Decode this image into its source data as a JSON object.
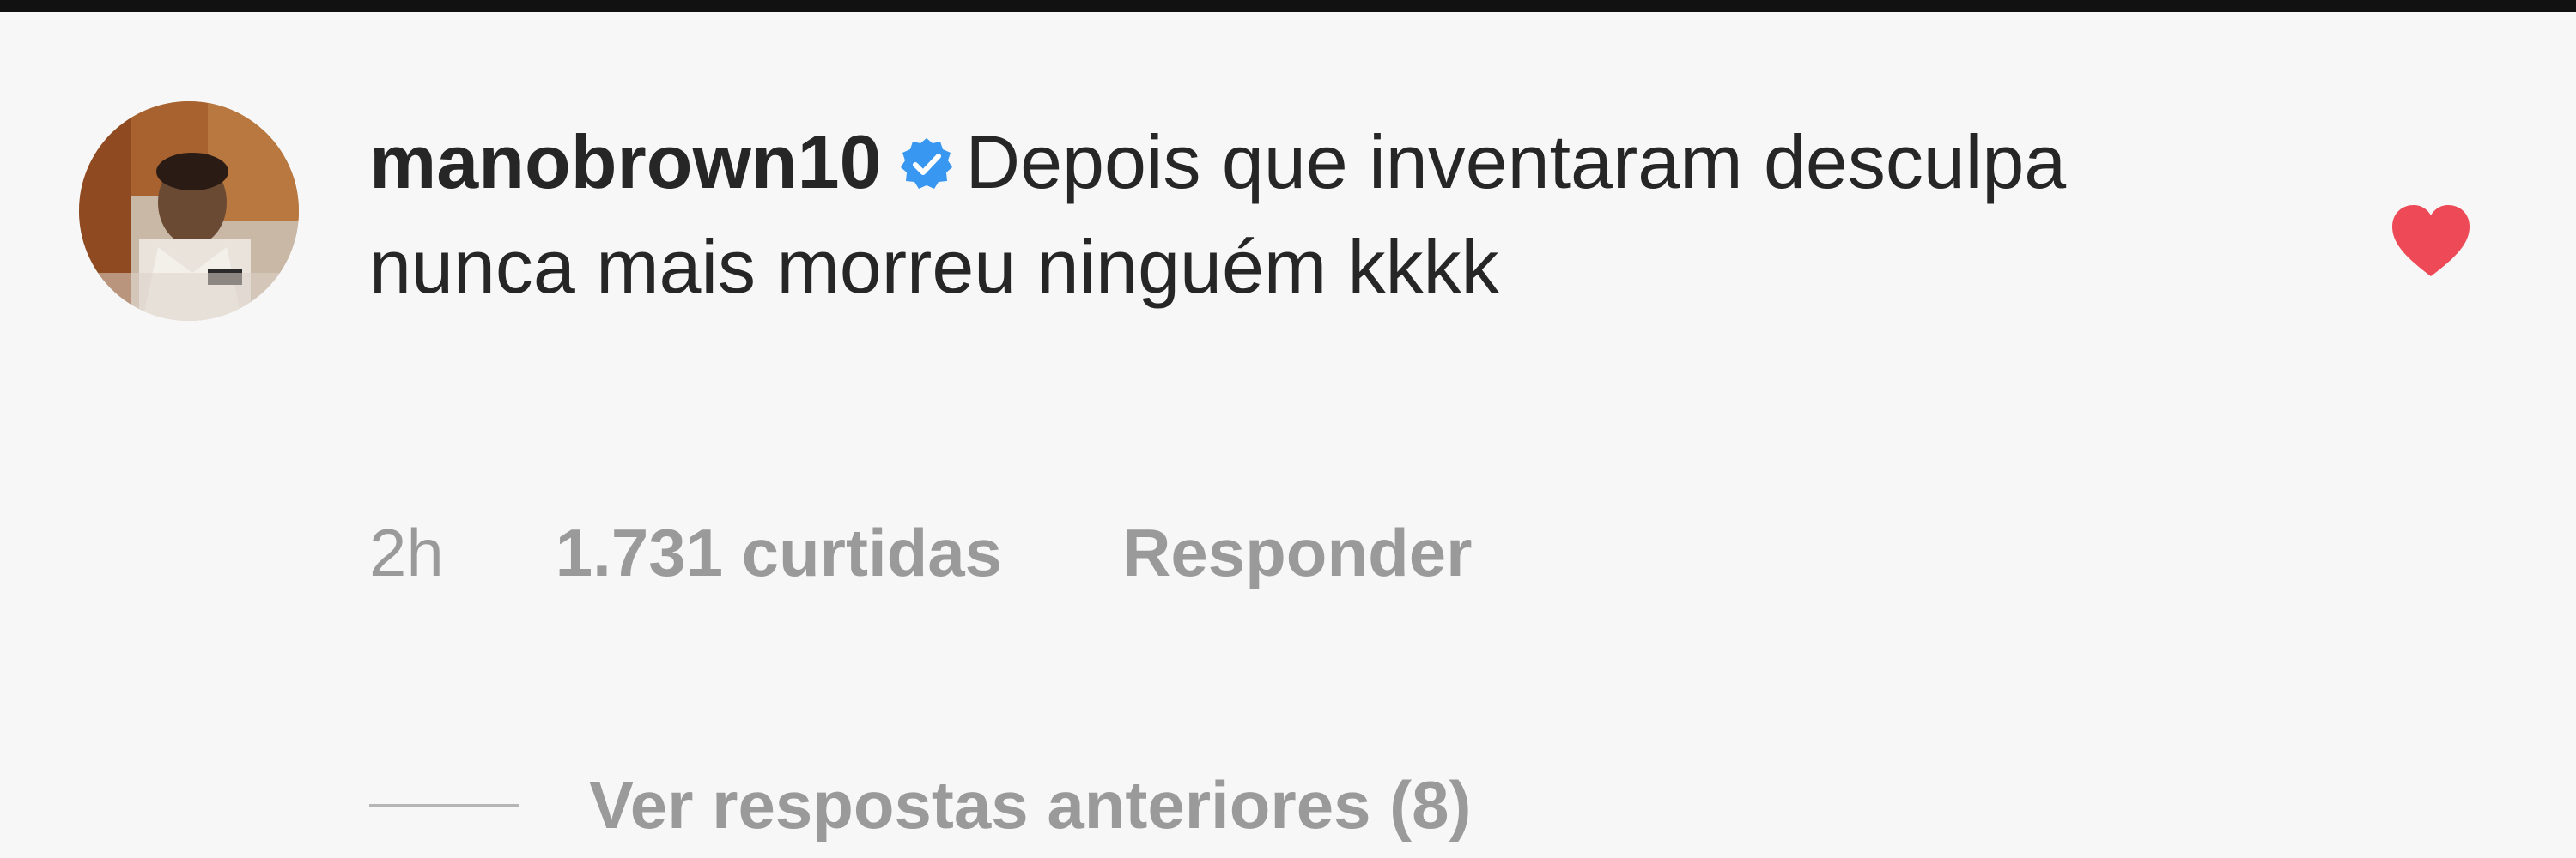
{
  "comment": {
    "username": "manobrown10",
    "verified": true,
    "text": "Depois que inventaram desculpa nunca mais morreu ninguém kkkk",
    "liked": true
  },
  "meta": {
    "time": "2h",
    "likes": "1.731 curtidas",
    "reply_label": "Responder"
  },
  "replies": {
    "label": "Ver respostas anteriores (8)"
  },
  "icons": {
    "verified": "verified-badge-icon",
    "like": "heart-icon"
  },
  "colors": {
    "verified_badge": "#3897f0",
    "liked_heart": "#ed4956",
    "meta_text": "#9a9a9a",
    "body_text": "#262626"
  }
}
